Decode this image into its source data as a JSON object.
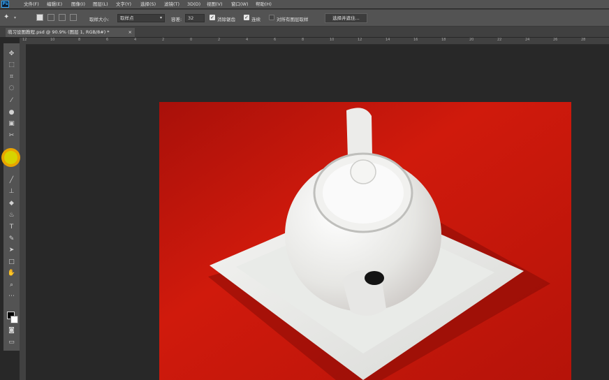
{
  "app": {
    "logo": "Ps"
  },
  "menu": [
    "文件(F)",
    "编辑(E)",
    "图像(I)",
    "图层(L)",
    "文字(Y)",
    "选择(S)",
    "滤镜(T)",
    "3D(D)",
    "视图(V)",
    "窗口(W)",
    "帮助(H)"
  ],
  "options": {
    "sample_size_label": "取样大小:",
    "sample_size_value": "取样点",
    "tolerance_label": "容差:",
    "tolerance_value": "32",
    "antialias_label": "消除锯齿",
    "contiguous_label": "连续",
    "sample_all_label": "对所有图层取样",
    "select_mask_label": "选择并遮住..."
  },
  "document_tab": {
    "title": "萌习设图教程.psd @ 90.9% (图层 1, RGB/8#) *",
    "close": "×"
  },
  "ruler": {
    "ticks": [
      "12",
      "10",
      "8",
      "6",
      "4",
      "2",
      "0",
      "2",
      "4",
      "6",
      "8",
      "10",
      "12",
      "14",
      "16",
      "18",
      "20",
      "22",
      "24",
      "26",
      "28"
    ]
  },
  "colors": {
    "panel": "#535353",
    "workspace": "#282828",
    "highlight": "#e9a400",
    "tablecloth": "#c8160b"
  },
  "icons": [
    "move-icon",
    "marquee-icon",
    "lasso-icon",
    "crop-icon",
    "eyedropper-icon",
    "spot-heal-icon",
    "brush-icon",
    "stamp-icon",
    "history-brush-icon",
    "eraser-icon",
    "gradient-icon",
    "blur-icon",
    "dodge-icon",
    "pen-icon",
    "type-icon",
    "path-select-icon",
    "rectangle-icon",
    "hand-icon",
    "zoom-icon"
  ]
}
